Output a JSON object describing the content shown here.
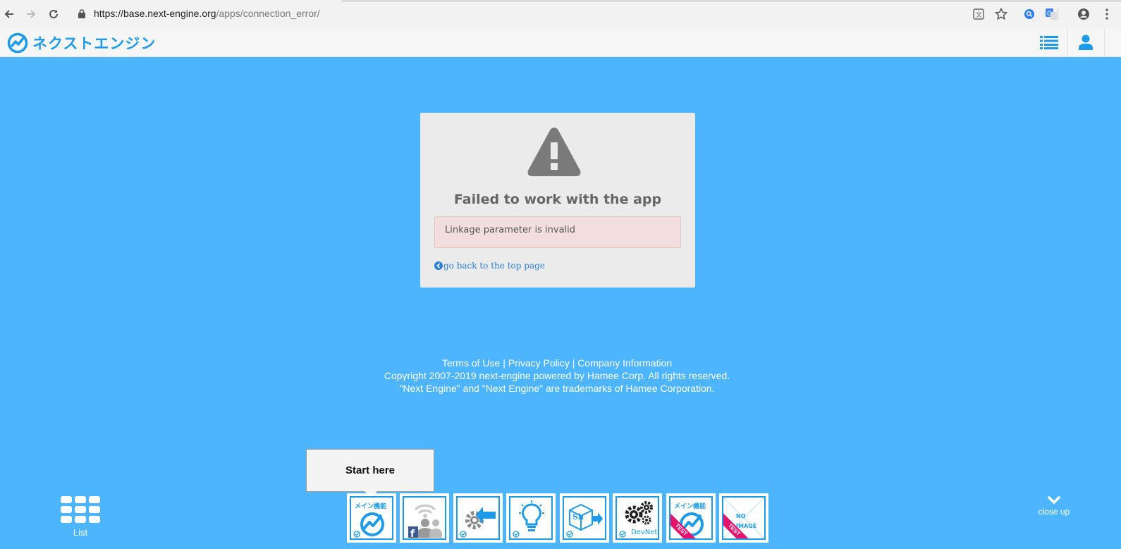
{
  "browser": {
    "url_host": "https://base.next-engine.org",
    "url_path": "/apps/connection_error/"
  },
  "header": {
    "logo_text": "ネクストエンジン"
  },
  "error_card": {
    "title": "Failed to work with the app",
    "message": "Linkage parameter is invalid",
    "back_link": "go back to the top page"
  },
  "footer": {
    "links": [
      "Terms of Use",
      "Privacy Policy",
      "Company Information"
    ],
    "separator": " | ",
    "copyright": "Copyright 2007-2019 next-engine powered by Hamee Corp. All rights reserved.",
    "trademark": "\"Next Engine\" and \"Next Engine\" are trademarks of Hamee Corporation."
  },
  "dock": {
    "list_label": "List",
    "tooltip": "Start here",
    "close_label": "close up",
    "tiles": [
      {
        "label": "メイン機能",
        "icon": "next-engine-main-icon"
      },
      {
        "label": "",
        "icon": "facebook-users-icon"
      },
      {
        "label": "",
        "icon": "gear-arrow-icon"
      },
      {
        "label": "",
        "icon": "lightbulb-icon"
      },
      {
        "label": "Sh",
        "icon": "shipping-box-icon"
      },
      {
        "label": "DevNet",
        "icon": "devnet-gears-icon"
      },
      {
        "label": "メイン機能",
        "ribbon": "TEST",
        "icon": "next-engine-main-test-icon"
      },
      {
        "label": "NO IMAGE",
        "ribbon": "TEST",
        "icon": "no-image-test-icon"
      }
    ]
  },
  "colors": {
    "page_bg": "#4db5fd",
    "brand_blue": "#1e9be8",
    "error_bg": "#f2dede",
    "ribbon_pink": "#e4136d"
  }
}
